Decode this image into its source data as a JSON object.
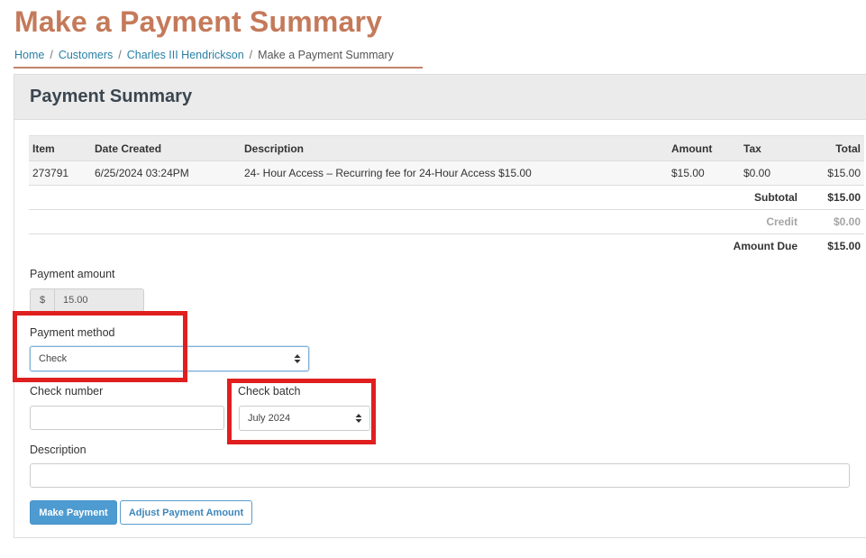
{
  "page": {
    "title": "Make a Payment Summary"
  },
  "breadcrumb": {
    "items": [
      "Home",
      "Customers",
      "Charles III Hendrickson"
    ],
    "current": "Make a Payment Summary",
    "separator": "/"
  },
  "panel": {
    "title": "Payment Summary"
  },
  "table": {
    "headers": {
      "item": "Item",
      "date": "Date Created",
      "description": "Description",
      "amount": "Amount",
      "tax": "Tax",
      "total": "Total"
    },
    "rows": [
      {
        "item": "273791",
        "date": "6/25/2024 03:24PM",
        "description": "24- Hour Access – Recurring fee for 24-Hour Access $15.00",
        "amount": "$15.00",
        "tax": "$0.00",
        "total": "$15.00"
      }
    ],
    "summary": {
      "subtotal_label": "Subtotal",
      "subtotal": "$15.00",
      "credit_label": "Credit",
      "credit": "$0.00",
      "amount_due_label": "Amount Due",
      "amount_due": "$15.00"
    }
  },
  "form": {
    "payment_amount_label": "Payment amount",
    "currency_symbol": "$",
    "payment_amount": "15.00",
    "payment_method_label": "Payment method",
    "payment_method": "Check",
    "check_number_label": "Check number",
    "check_number": "",
    "check_batch_label": "Check batch",
    "check_batch": "July 2024",
    "description_label": "Description",
    "description": ""
  },
  "buttons": {
    "make_payment": "Make Payment",
    "adjust_amount": "Adjust Payment Amount"
  },
  "colors": {
    "title": "#c47a5a",
    "link": "#2a7fa5",
    "primary": "#4e9bd1",
    "annotation": "#e01f1f"
  }
}
